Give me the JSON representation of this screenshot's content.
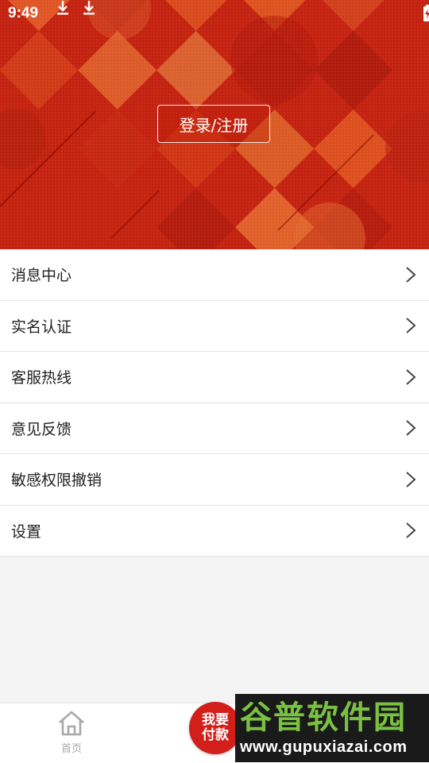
{
  "status_bar": {
    "time": "9:49",
    "icons": [
      "download-icon",
      "download-icon",
      "wifi-icon",
      "signal-icon",
      "battery-charging-icon"
    ]
  },
  "header": {
    "login_label": "登录/注册"
  },
  "menu": {
    "items": [
      {
        "label": "消息中心",
        "icon": "chevron-right-icon"
      },
      {
        "label": "实名认证",
        "icon": "chevron-right-icon"
      },
      {
        "label": "客服热线",
        "icon": "chevron-right-icon"
      },
      {
        "label": "意见反馈",
        "icon": "chevron-right-icon"
      },
      {
        "label": "敏感权限撤销",
        "icon": "chevron-right-icon"
      },
      {
        "label": "设置",
        "icon": "chevron-right-icon"
      }
    ]
  },
  "tabbar": {
    "home_label": "首页",
    "home_icon": "home-icon",
    "pay_line1": "我要",
    "pay_line2": "付款"
  },
  "watermark": {
    "title": "谷普软件园",
    "url": "www.gupuxiazai.com"
  },
  "colors": {
    "banner_red": "#c9230f",
    "accent_orange": "#e0531f",
    "pay_red": "#d21f1a",
    "watermark_green": "#7ac143"
  }
}
